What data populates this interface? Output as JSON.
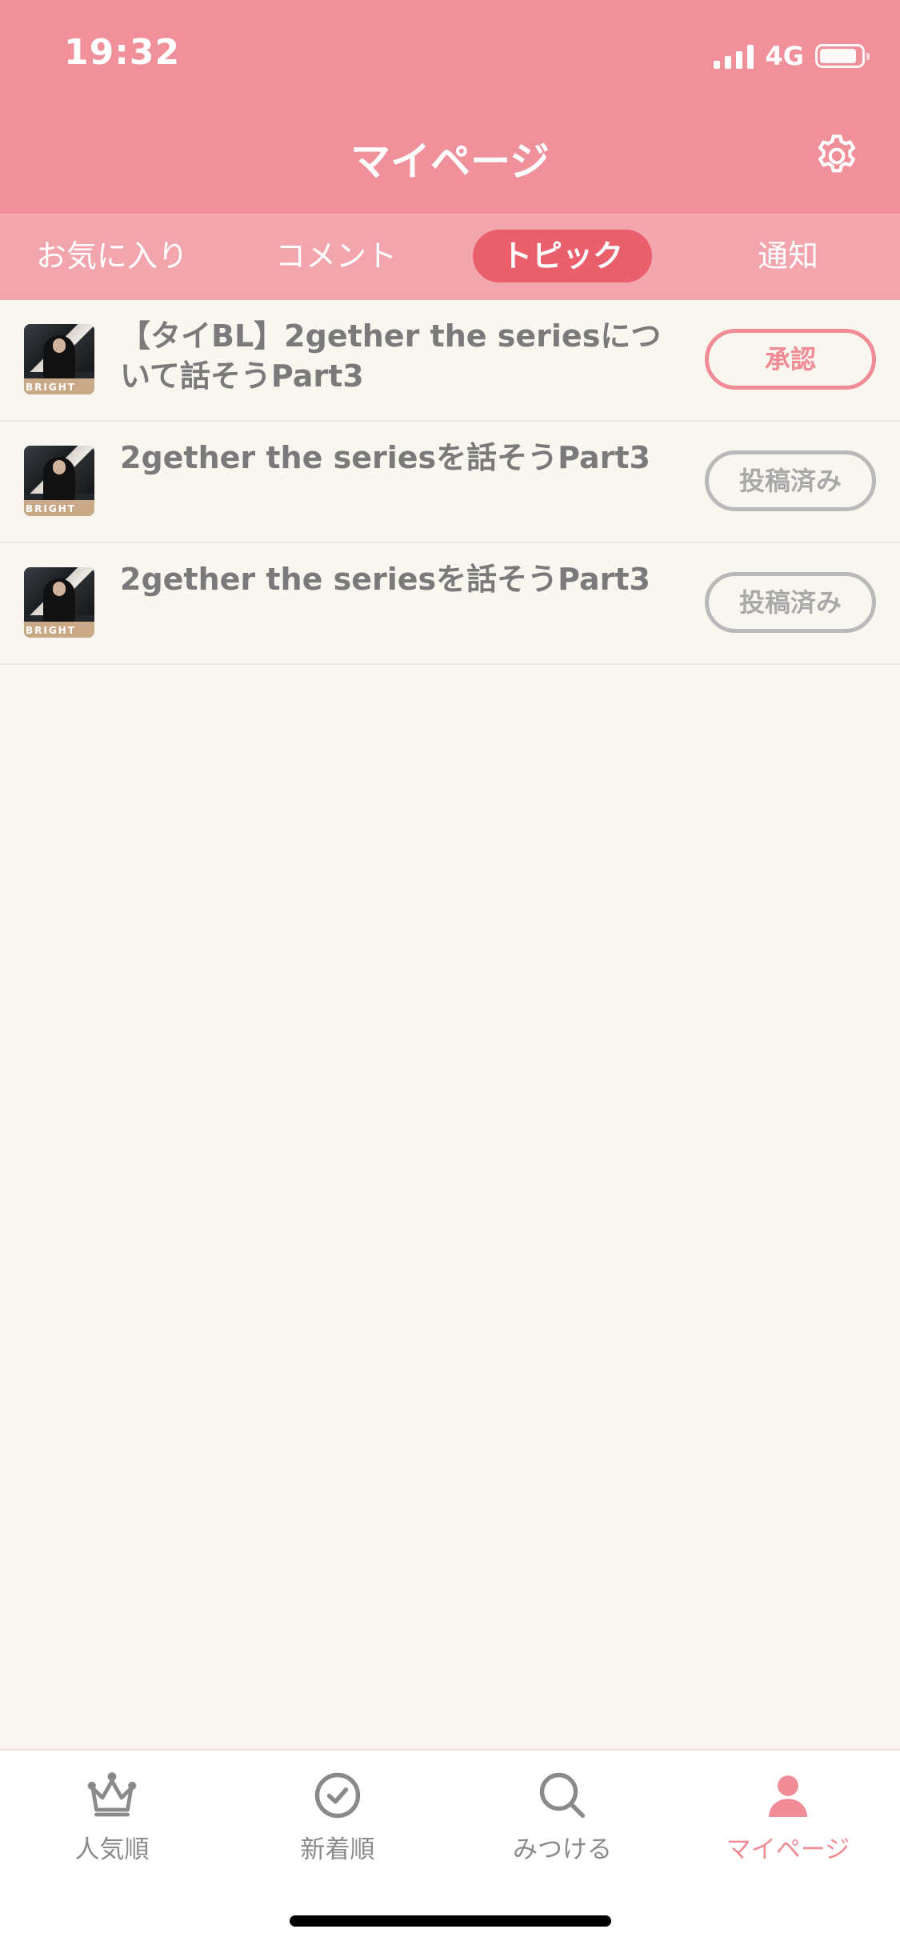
{
  "status_bar": {
    "time": "19:32",
    "network": "4G"
  },
  "header": {
    "title": "マイページ",
    "settings_icon": "gear-icon"
  },
  "tabs": [
    {
      "label": "お気に入り",
      "active": false
    },
    {
      "label": "コメント",
      "active": false
    },
    {
      "label": "トピック",
      "active": true
    },
    {
      "label": "通知",
      "active": false
    }
  ],
  "topics": [
    {
      "title": "【タイBL】2gether the seriesについて話そうPart3",
      "status": "承認",
      "status_type": "approve",
      "thumb_text": "BRIGHT"
    },
    {
      "title": "2gether the seriesを話そうPart3",
      "status": "投稿済み",
      "status_type": "posted",
      "thumb_text": "BRIGHT"
    },
    {
      "title": "2gether the seriesを話そうPart3",
      "status": "投稿済み",
      "status_type": "posted",
      "thumb_text": "BRIGHT"
    }
  ],
  "bottom_nav": [
    {
      "label": "人気順",
      "icon": "crown-icon",
      "active": false
    },
    {
      "label": "新着順",
      "icon": "clock-icon",
      "active": false
    },
    {
      "label": "みつける",
      "icon": "search-icon",
      "active": false
    },
    {
      "label": "マイページ",
      "icon": "person-icon",
      "active": true
    }
  ],
  "colors": {
    "header": "#f0909a",
    "tab_bar": "#f3a5ad",
    "tab_active": "#e95f6b",
    "accent": "#ef8c96",
    "background": "#f9f5ef"
  }
}
